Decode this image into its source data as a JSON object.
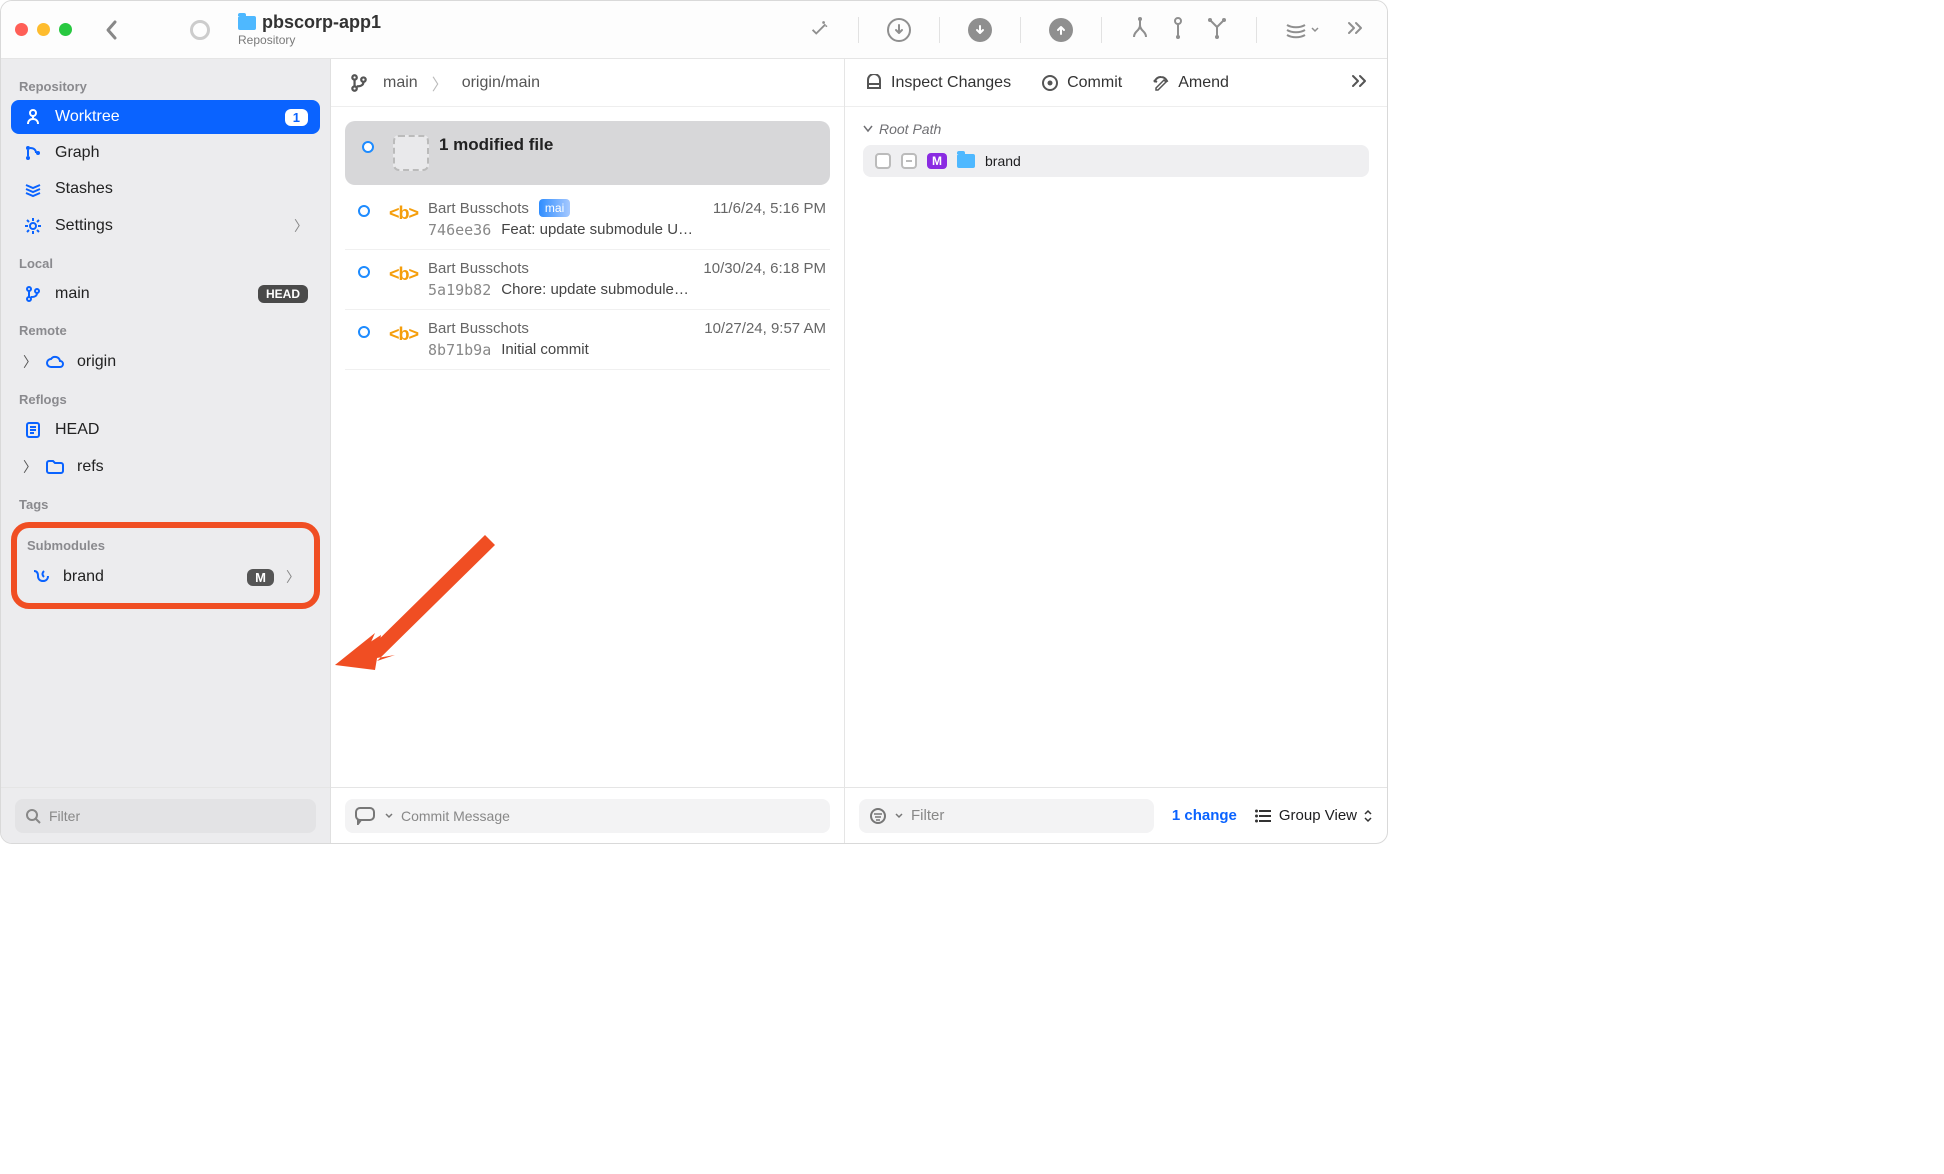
{
  "toolbar": {
    "title": "pbscorp-app1",
    "subtitle": "Repository"
  },
  "sidebar": {
    "sections": {
      "repository": {
        "title": "Repository",
        "items": [
          {
            "label": "Worktree",
            "badge": "1"
          },
          {
            "label": "Graph"
          },
          {
            "label": "Stashes"
          },
          {
            "label": "Settings"
          }
        ]
      },
      "local": {
        "title": "Local",
        "items": [
          {
            "label": "main",
            "badge": "HEAD"
          }
        ]
      },
      "remote": {
        "title": "Remote",
        "items": [
          {
            "label": "origin"
          }
        ]
      },
      "reflogs": {
        "title": "Reflogs",
        "items": [
          {
            "label": "HEAD"
          },
          {
            "label": "refs"
          }
        ]
      },
      "tags": {
        "title": "Tags"
      },
      "submodules": {
        "title": "Submodules",
        "items": [
          {
            "label": "brand",
            "badge": "M"
          }
        ]
      }
    },
    "filter_placeholder": "Filter"
  },
  "breadcrumb": {
    "branch": "main",
    "remote": "origin/main"
  },
  "worktree_summary": "1 modified file",
  "commits": [
    {
      "author": "Bart Busschots",
      "tag": "mai",
      "date": "11/6/24,  5:16 PM",
      "sha": "746ee36",
      "msg": "Feat: update submodule U…"
    },
    {
      "author": "Bart Busschots",
      "date": "10/30/24,  6:18 PM",
      "sha": "5a19b82",
      "msg": "Chore: update submodule…"
    },
    {
      "author": "Bart Busschots",
      "date": "10/27/24,  9:57 AM",
      "sha": "8b71b9a",
      "msg": "Initial commit"
    }
  ],
  "commit_message_placeholder": "Commit Message",
  "inspector": {
    "tabs": {
      "inspect": "Inspect Changes",
      "commit": "Commit",
      "amend": "Amend"
    },
    "root_label": "Root Path",
    "entry": {
      "name": "brand",
      "badge": "M"
    },
    "filter_placeholder": "Filter",
    "change_count": "1 change",
    "group_view": "Group View"
  }
}
